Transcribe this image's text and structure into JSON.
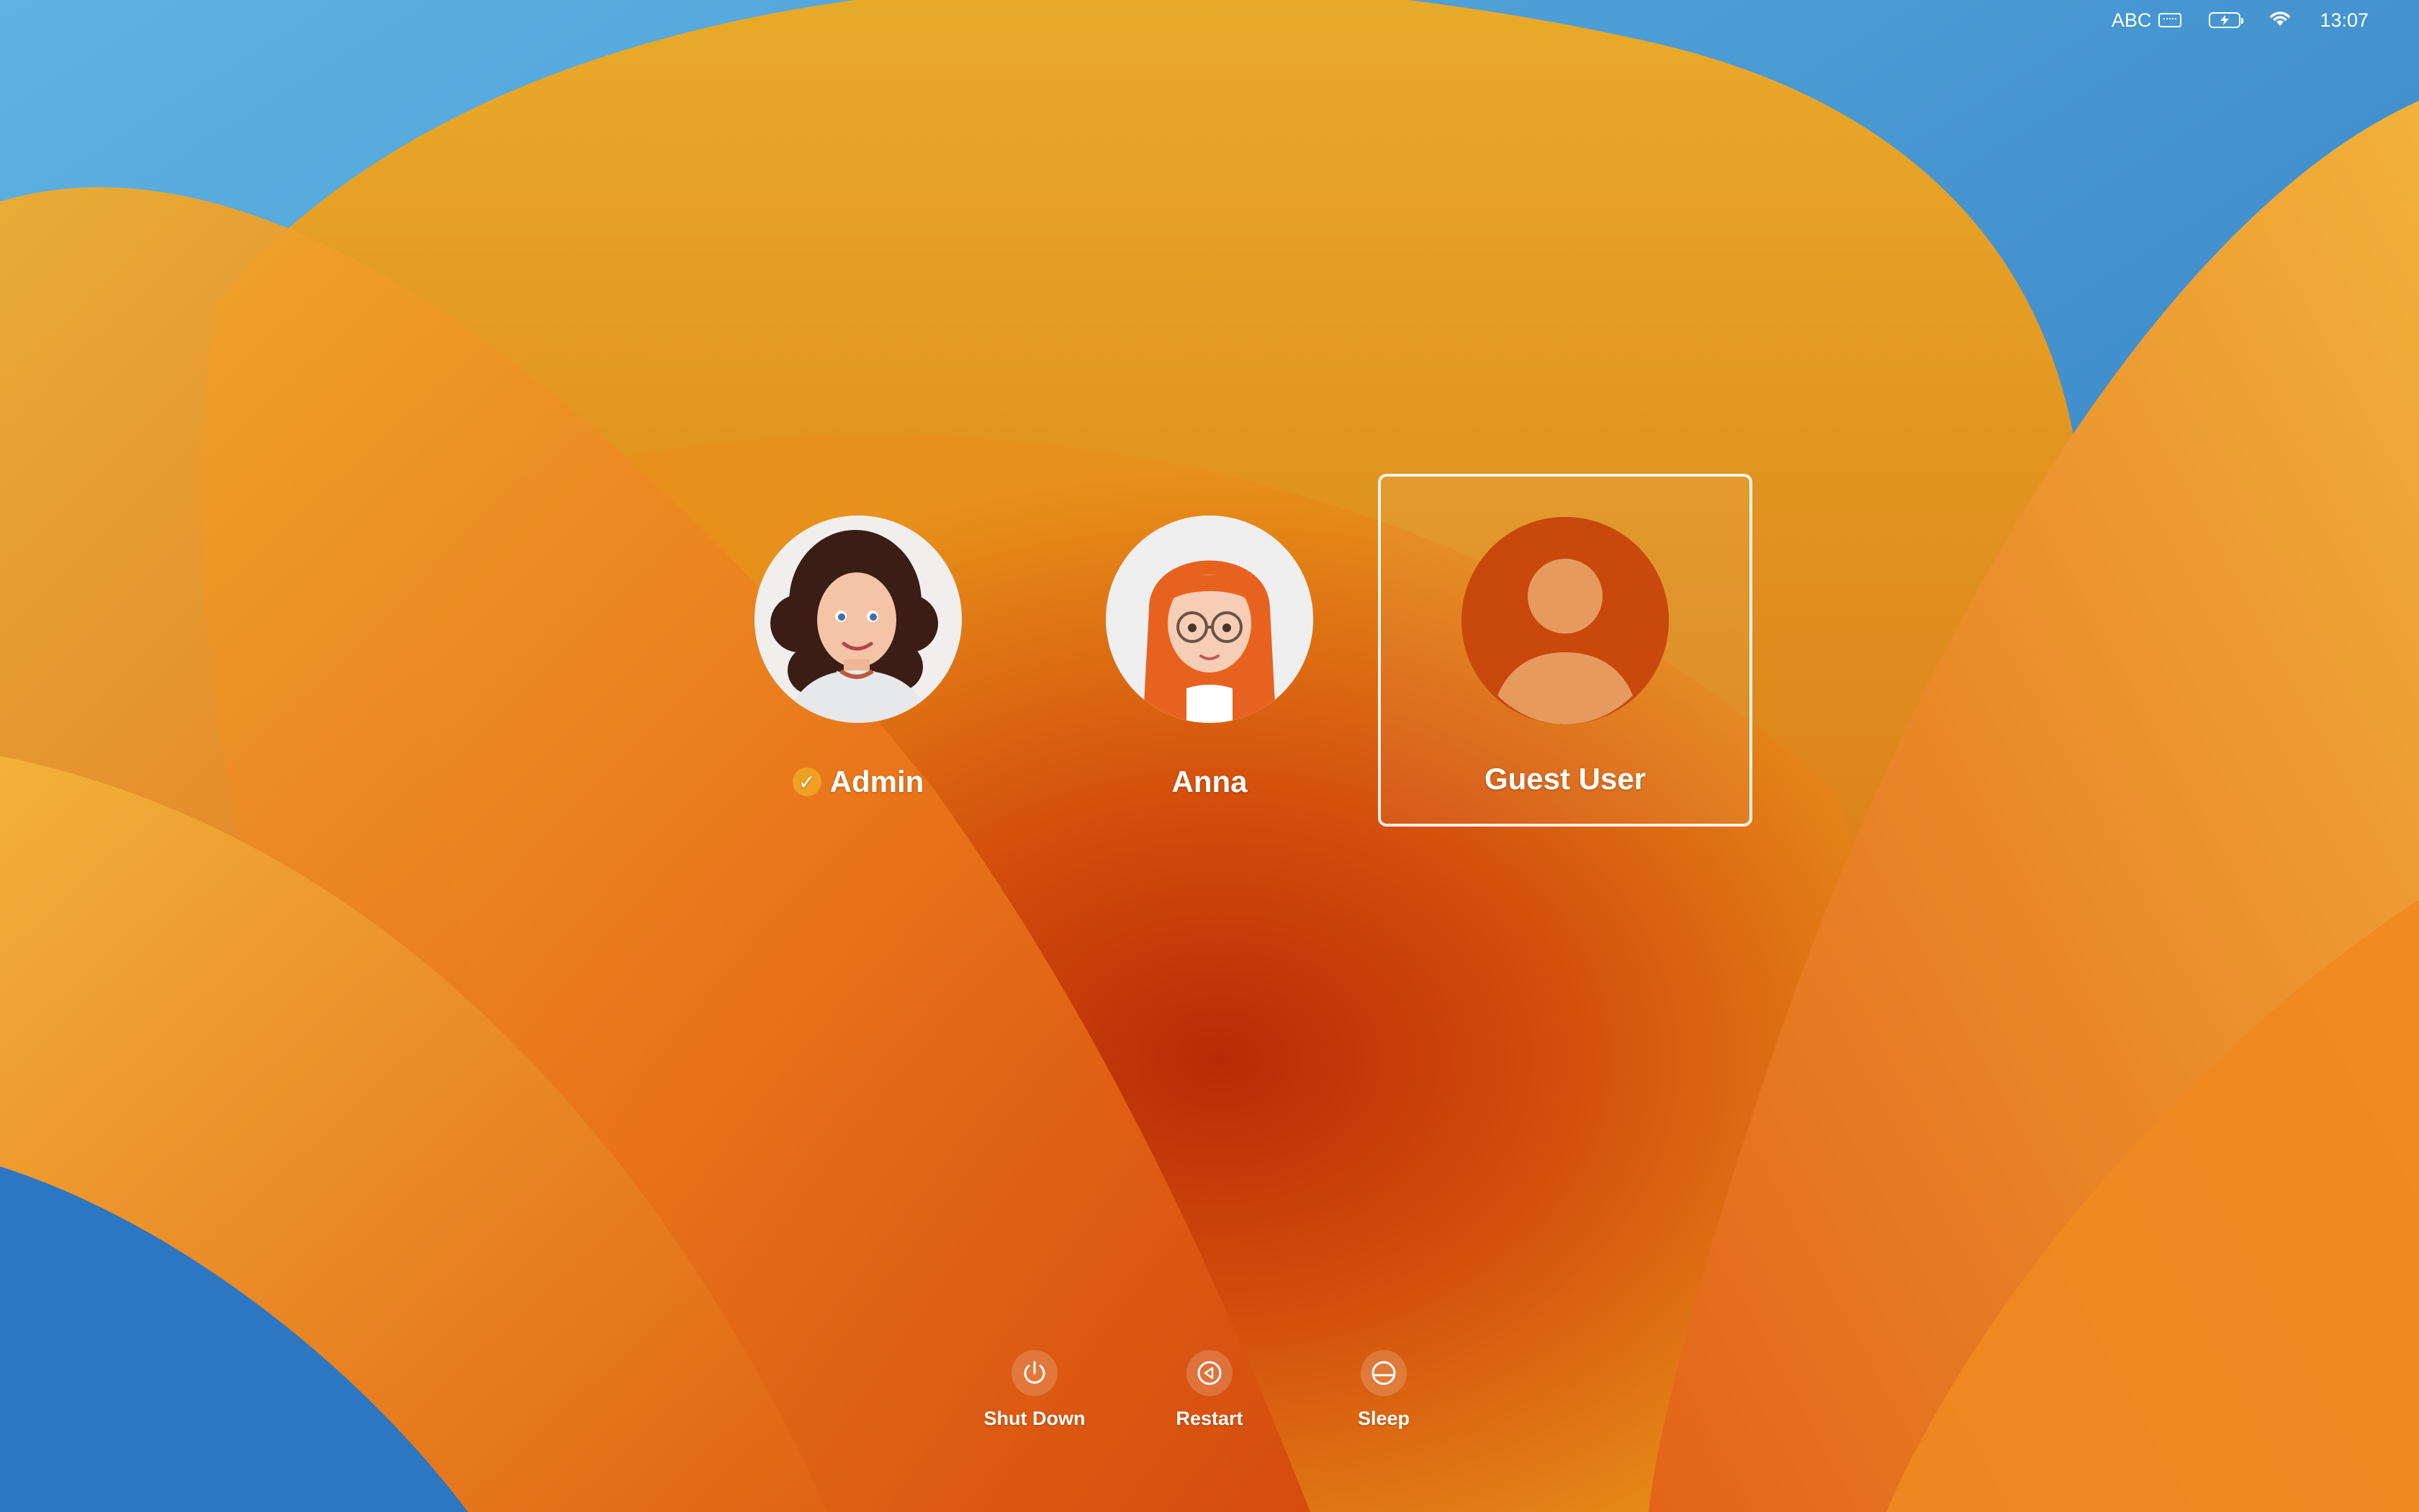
{
  "menubar": {
    "input_source": "ABC",
    "keyboard_icon": "keyboard-icon",
    "battery_icon": "battery-charging-icon",
    "wifi_icon": "wifi-icon",
    "clock": "13:07"
  },
  "users": [
    {
      "name": "Admin",
      "logged_in": true,
      "avatar": "memoji-curly-hair"
    },
    {
      "name": "Anna",
      "logged_in": false,
      "avatar": "memoji-red-hair-glasses"
    },
    {
      "name": "Guest User",
      "logged_in": false,
      "selected": true,
      "avatar": "generic-person-icon"
    }
  ],
  "power": {
    "shutdown_label": "Shut Down",
    "restart_label": "Restart",
    "sleep_label": "Sleep"
  },
  "colors": {
    "accent_badge": "#f0a024",
    "wallpaper_orange": "#e2760f",
    "wallpaper_blue": "#2f7fc4"
  }
}
